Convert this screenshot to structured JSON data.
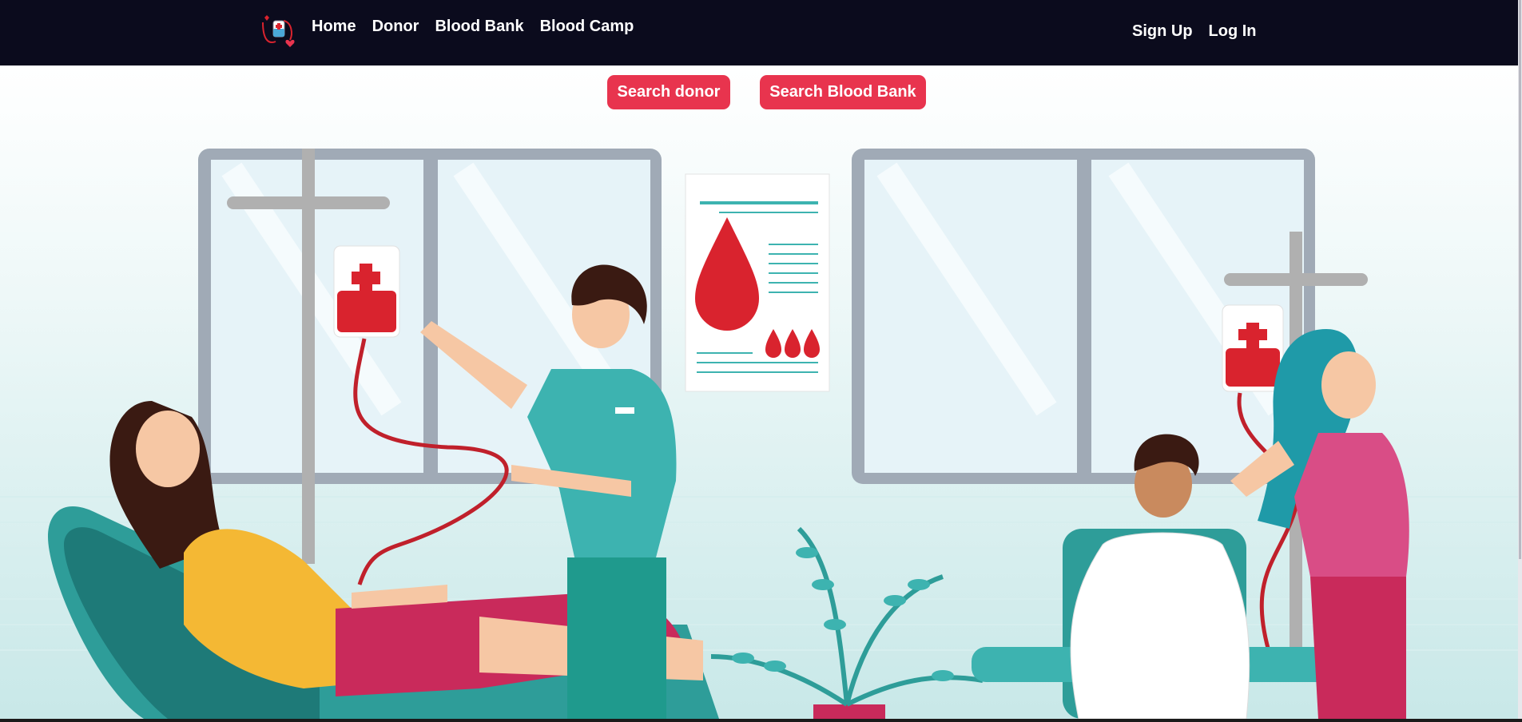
{
  "nav": {
    "logo_icon": "blood-donation-logo-icon",
    "links": [
      {
        "label": "Home"
      },
      {
        "label": "Donor"
      },
      {
        "label": "Blood Bank"
      },
      {
        "label": "Blood Camp"
      }
    ],
    "auth": {
      "signup_label": "Sign Up",
      "login_label": "Log In"
    }
  },
  "actions": {
    "search_donor_label": "Search donor",
    "search_bank_label": "Search Blood Bank"
  },
  "hero": {
    "illustration": "blood-donation-clinic-illustration"
  },
  "colors": {
    "navbar_bg": "#0b0b1d",
    "accent": "#e8344e",
    "blood_red": "#d9232e",
    "scrub_teal": "#3db3b0"
  }
}
